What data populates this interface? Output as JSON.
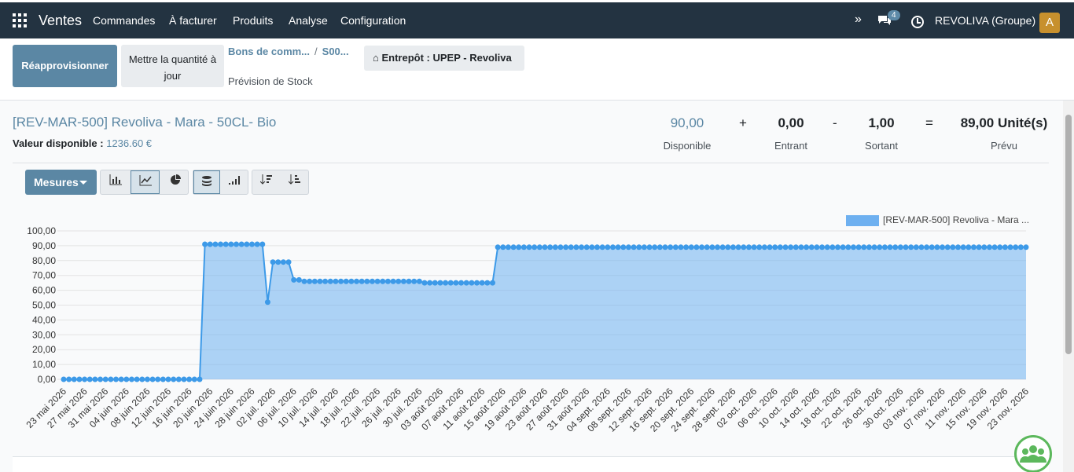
{
  "navbar": {
    "app_name": "Ventes",
    "menus": [
      "Commandes",
      "À facturer",
      "Produits",
      "Analyse",
      "Configuration"
    ],
    "more_icon": "»",
    "chat_badge": "4",
    "company": "REVOLIVA (Groupe)",
    "avatar_letter": "A"
  },
  "control_panel": {
    "replenish_label": "Réapprovisionner",
    "update_qty_label": "Mettre la quantité à jour",
    "breadcrumb": [
      "Bons de comm...",
      "S00..."
    ],
    "breadcrumb_sep": "/",
    "page_title": "Prévision de Stock",
    "warehouse_label": "Entrepôt : UPEP - Revoliva"
  },
  "product": {
    "name": "[REV-MAR-500] Revoliva - Mara - 50CL- Bio",
    "value_label": "Valeur disponible :",
    "value": "1236.60 €"
  },
  "kpis": {
    "available": "90,00",
    "available_label": "Disponible",
    "plus": "+",
    "incoming": "0,00",
    "incoming_label": "Entrant",
    "minus": "-",
    "outgoing": "1,00",
    "outgoing_label": "Sortant",
    "equals": "=",
    "forecast": "89,00 Unité(s)",
    "forecast_label": "Prévu"
  },
  "toolbar": {
    "measures_label": "Mesures",
    "icons": [
      "bar-chart-icon",
      "line-chart-icon",
      "pie-chart-icon",
      "stacked-icon",
      "cumulative-icon",
      "sort-desc-icon",
      "sort-asc-icon"
    ]
  },
  "chart_data": {
    "type": "area",
    "legend": "[REV-MAR-500] Revoliva - Mara ...",
    "color": "#6eb0f0",
    "ylim": [
      0,
      100
    ],
    "yticks": [
      "0,00",
      "10,00",
      "20,00",
      "30,00",
      "40,00",
      "50,00",
      "60,00",
      "70,00",
      "80,00",
      "90,00",
      "100,00"
    ],
    "x_ticks": [
      "23 mai 2026",
      "27 mai 2026",
      "31 mai 2026",
      "04 juin 2026",
      "08 juin 2026",
      "12 juin 2026",
      "16 juin 2026",
      "20 juin 2026",
      "24 juin 2026",
      "28 juin 2026",
      "02 juil. 2026",
      "06 juil. 2026",
      "10 juil. 2026",
      "14 juil. 2026",
      "18 juil. 2026",
      "22 juil. 2026",
      "26 juil. 2026",
      "30 juil. 2026",
      "03 août 2026",
      "07 août 2026",
      "11 août 2026",
      "15 août 2026",
      "19 août 2026",
      "23 août 2026",
      "27 août 2026",
      "31 août 2026",
      "04 sept. 2026",
      "08 sept. 2026",
      "12 sept. 2026",
      "16 sept. 2026",
      "20 sept. 2026",
      "24 sept. 2026",
      "28 sept. 2026",
      "02 oct. 2026",
      "06 oct. 2026",
      "10 oct. 2026",
      "14 oct. 2026",
      "18 oct. 2026",
      "22 oct. 2026",
      "26 oct. 2026",
      "30 oct. 2026",
      "03 nov. 2026",
      "07 nov. 2026",
      "11 nov. 2026",
      "15 nov. 2026",
      "19 nov. 2026",
      "23 nov. 2026"
    ],
    "segments": [
      {
        "from": "23 mai 2026",
        "to": "18 juin 2026",
        "value": 0
      },
      {
        "from": "19 juin 2026",
        "to": "30 juin 2026",
        "value": 91
      },
      {
        "from": "01 juil. 2026",
        "to": "01 juil. 2026",
        "value": 52
      },
      {
        "from": "02 juil. 2026",
        "to": "05 juil. 2026",
        "value": 79
      },
      {
        "from": "06 juil. 2026",
        "to": "07 juil. 2026",
        "value": 67
      },
      {
        "from": "08 juil. 2026",
        "to": "30 juil. 2026",
        "value": 66
      },
      {
        "from": "31 juil. 2026",
        "to": "13 août 2026",
        "value": 65
      },
      {
        "from": "14 août 2026",
        "to": "23 nov. 2026",
        "value": 89
      }
    ]
  }
}
